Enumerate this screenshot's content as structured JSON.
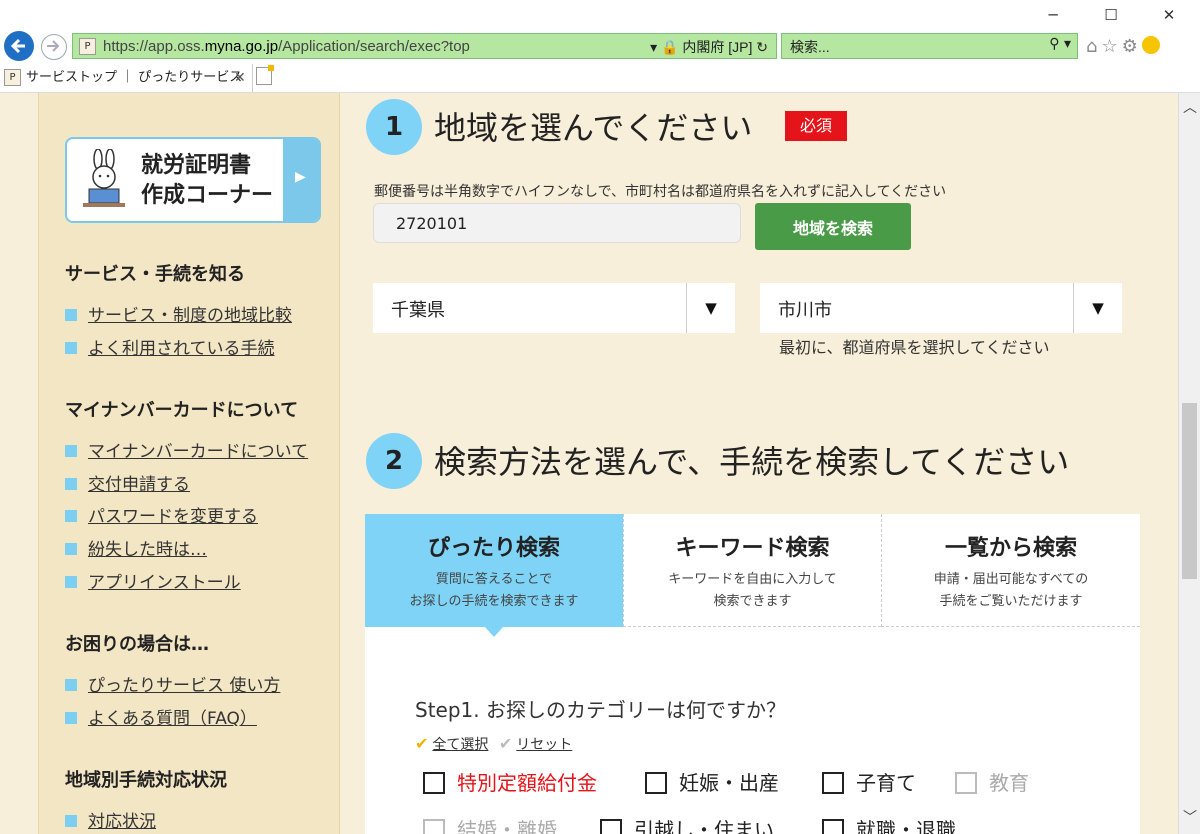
{
  "browser": {
    "url_prefix": "https://app.oss.",
    "url_domain": "myna.go.jp",
    "url_path": "/Application/search/exec?top",
    "site_identity": "内閣府 [JP]",
    "search_placeholder": "検索...",
    "tab_title": "サービストップ ｜ ぴったりサービス"
  },
  "sidebar": {
    "banner_line1": "就労証明書",
    "banner_line2": "作成コーナー",
    "sections": [
      {
        "title": "サービス・手続を知る",
        "links": [
          "サービス・制度の地域比較",
          "よく利用されている手続"
        ]
      },
      {
        "title": "マイナンバーカードについて",
        "links": [
          "マイナンバーカードについて",
          "交付申請する",
          "パスワードを変更する",
          "紛失した時は…",
          "アプリインストール"
        ]
      },
      {
        "title": "お困りの場合は…",
        "links": [
          "ぴったりサービス 使い方",
          "よくある質問（FAQ）"
        ]
      },
      {
        "title": "地域別手続対応状況",
        "links": [
          "対応状況"
        ]
      }
    ]
  },
  "step1": {
    "number": "1",
    "title": "地域を選んでください",
    "required_badge": "必須",
    "hint": "郵便番号は半角数字でハイフンなしで、市町村名は都道府県名を入れずに記入してください",
    "postal_value": "2720101",
    "search_button": "地域を検索",
    "prefecture": "千葉県",
    "city": "市川市",
    "city_note": "最初に、都道府県を選択してください"
  },
  "step2": {
    "number": "2",
    "title": "検索方法を選んで、手続を検索してください",
    "tabs": [
      {
        "title": "ぴったり検索",
        "desc1": "質問に答えることで",
        "desc2": "お探しの手続を検索できます"
      },
      {
        "title": "キーワード検索",
        "desc1": "キーワードを自由に入力して",
        "desc2": "検索できます"
      },
      {
        "title": "一覧から検索",
        "desc1": "申請・届出可能なすべての",
        "desc2": "手続をご覧いただけます"
      }
    ],
    "question": "Step1. お探しのカテゴリーは何ですか？",
    "select_all": "全て選択",
    "reset": "リセット",
    "categories": [
      "特別定額給付金",
      "妊娠・出産",
      "子育て",
      "教育",
      "結婚・離婚",
      "引越し・住まい",
      "就職・退職"
    ]
  },
  "colors": {
    "page_bg": "#f8efda",
    "sidebar_bg": "#f3e6c4",
    "accent_blue": "#7fd3f6",
    "required_red": "#e4141a",
    "button_green": "#4a9b47",
    "address_bar_green": "#b5e7a0"
  }
}
